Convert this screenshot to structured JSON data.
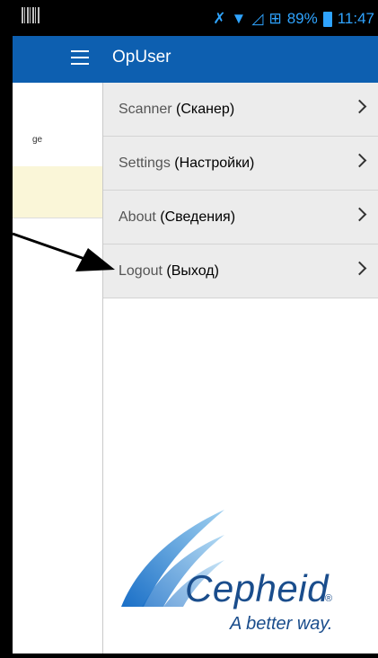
{
  "status_bar": {
    "battery_percent": "89%",
    "time": "11:47",
    "icons": [
      "barcode-icon",
      "mute-icon",
      "wifi-icon",
      "signal-icon",
      "network-icon",
      "battery-icon"
    ]
  },
  "background_app": {
    "row_text": "ge"
  },
  "drawer": {
    "title": "OpUser",
    "items": [
      {
        "label": "Scanner",
        "translation": "(Сканер)"
      },
      {
        "label": "Settings",
        "translation": "(Настройки)"
      },
      {
        "label": "About",
        "translation": "(Сведения)"
      },
      {
        "label": "Logout",
        "translation": "(Выход)"
      }
    ]
  },
  "logo": {
    "wordmark": "Cepheid",
    "registered": "®",
    "tagline": "A better way."
  },
  "colors": {
    "toolbar": "#0d5fb0",
    "status_accent": "#2fa4ff",
    "menu_bg": "#ececec",
    "brand": "#1a4d8c"
  }
}
